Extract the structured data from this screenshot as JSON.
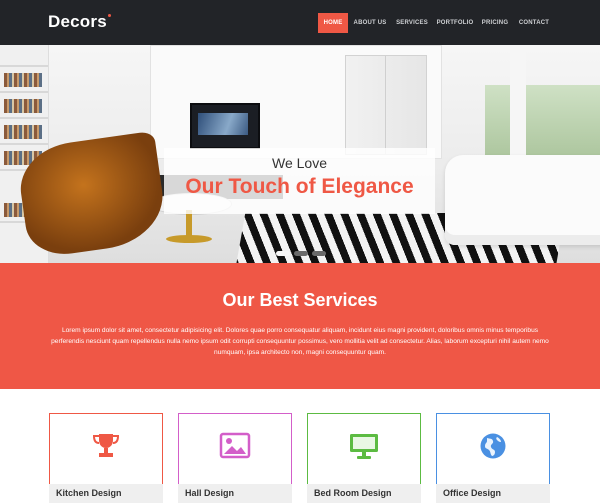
{
  "brand": {
    "logo_main": "D",
    "logo_rest": "ecors",
    "accent": "#ef5845"
  },
  "nav": {
    "items": [
      {
        "label": "HOME",
        "active": true
      },
      {
        "label": "ABOUT US",
        "active": false
      },
      {
        "label": "SERVICES",
        "active": false
      },
      {
        "label": "PORTFOLIO",
        "active": false
      },
      {
        "label": "PRICING",
        "active": false
      },
      {
        "label": "CONTACT",
        "active": false
      }
    ]
  },
  "hero": {
    "subtitle": "We Love",
    "title": "Our Touch of Elegance",
    "slides": 3,
    "active_slide": 1
  },
  "services": {
    "title": "Our Best Services",
    "text": "Lorem ipsum dolor sit amet, consectetur adipisicing elit. Dolores quae porro consequatur aliquam, incidunt eius magni provident, doloribus omnis minus temporibus perferendis nesciunt quam repellendus nulla nemo ipsum odit corrupti consequuntur possimus, vero mollitia velit ad consectetur. Alias, laborum excepturi nihil autem nemo numquam, ipsa architecto non, magni consequuntur quam.",
    "background": "#ef5746"
  },
  "cards": [
    {
      "label": "Kitchen Design",
      "icon": "trophy-icon",
      "color": "#ef5845"
    },
    {
      "label": "Hall Design",
      "icon": "image-icon",
      "color": "#d35ec9"
    },
    {
      "label": "Bed Room Design",
      "icon": "monitor-icon",
      "color": "#5cbb42"
    },
    {
      "label": "Office Design",
      "icon": "globe-icon",
      "color": "#4a90e2"
    }
  ]
}
